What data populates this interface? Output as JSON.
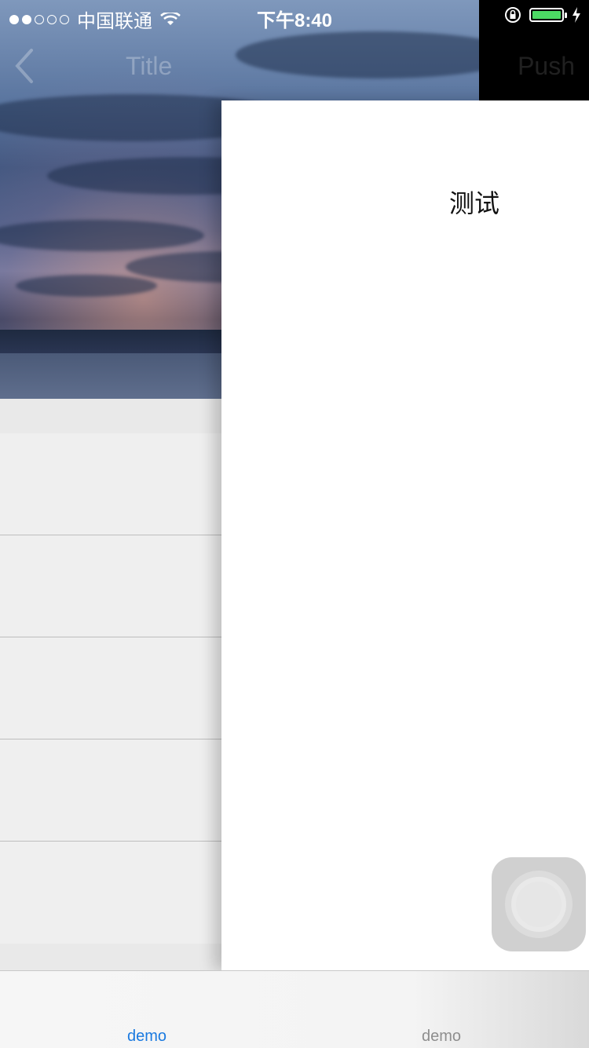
{
  "status_bar": {
    "carrier": "中国联通",
    "time": "下午8:40"
  },
  "nav": {
    "title": "Title",
    "right_button": "Push"
  },
  "drawer": {
    "text": "测试"
  },
  "tabs": [
    {
      "label": "demo",
      "selected": true
    },
    {
      "label": "demo",
      "selected": false
    }
  ],
  "colors": {
    "tab_selected": "#1a7ae0",
    "tab_unselected": "#8e8e8e",
    "battery": "#4cd964"
  }
}
